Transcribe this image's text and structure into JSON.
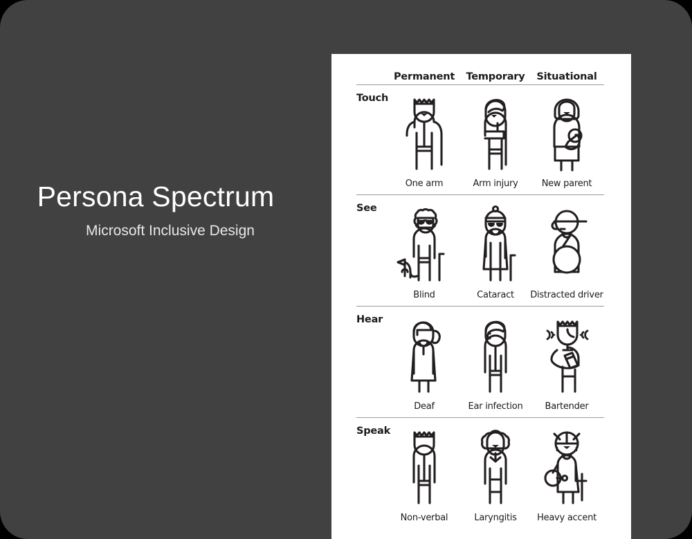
{
  "slide": {
    "background_color": "#414141",
    "card_color": "#ffffff",
    "title": "Persona Spectrum",
    "subtitle": "Microsoft Inclusive Design"
  },
  "matrix": {
    "column_headers": [
      "Permanent",
      "Temporary",
      "Situational"
    ],
    "row_headers": [
      "Touch",
      "See",
      "Hear",
      "Speak"
    ],
    "rows": [
      {
        "label": "Touch",
        "cells": [
          {
            "caption": "One arm",
            "icon": "person-one-arm-icon"
          },
          {
            "caption": "Arm injury",
            "icon": "person-arm-sling-icon"
          },
          {
            "caption": "New parent",
            "icon": "person-holding-baby-icon"
          }
        ]
      },
      {
        "label": "See",
        "cells": [
          {
            "caption": "Blind",
            "icon": "person-blind-guide-dog-icon"
          },
          {
            "caption": "Cataract",
            "caption_alt": "Cataract",
            "icon": "person-cataract-cane-icon"
          },
          {
            "caption": "Distracted driver",
            "icon": "person-driver-steering-wheel-icon"
          }
        ]
      },
      {
        "label": "Hear",
        "cells": [
          {
            "caption": "Deaf",
            "icon": "person-deaf-icon"
          },
          {
            "caption": "Ear infection",
            "icon": "person-ear-infection-icon"
          },
          {
            "caption": "Bartender",
            "icon": "person-bartender-noise-icon"
          }
        ]
      },
      {
        "label": "Speak",
        "cells": [
          {
            "caption": "Non-verbal",
            "icon": "person-non-verbal-icon"
          },
          {
            "caption": "Laryngitis",
            "icon": "person-laryngitis-icon"
          },
          {
            "caption": "Heavy accent",
            "icon": "person-heavy-accent-icon"
          }
        ]
      }
    ]
  },
  "colors": {
    "panel": "#414141",
    "card": "#ffffff",
    "ink": "#1b1b1b",
    "divider": "#9a9a9a",
    "title_text": "#ffffff"
  }
}
